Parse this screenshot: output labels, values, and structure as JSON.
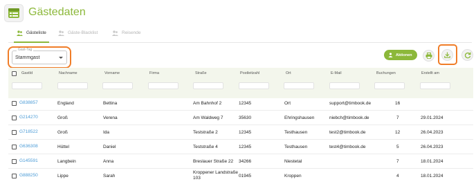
{
  "app": {
    "title": "Gästedaten",
    "icon": "guest-list-icon"
  },
  "tabs": [
    {
      "label": "Gästeliste",
      "icon": "users-icon",
      "active": true
    },
    {
      "label": "Gäste-Blacklist",
      "icon": "users-blocked-icon",
      "active": false
    },
    {
      "label": "Reisende",
      "icon": "travelers-icon",
      "active": false
    }
  ],
  "filter_tag": {
    "label": "Gast-Tag",
    "value": "Stammgast"
  },
  "toolbar": {
    "actions_label": "Aktionen",
    "print_icon": "printer-icon",
    "download_icon": "download-icon",
    "refresh_icon": "refresh-icon"
  },
  "colors": {
    "accent": "#8cb83a",
    "highlight": "#f07d28",
    "link": "#4a9bd6",
    "header_bg": "#f3f6ec"
  },
  "table": {
    "columns": [
      "GastId",
      "Nachname",
      "Vorname",
      "Firma",
      "Straße",
      "Postleitzahl",
      "Ort",
      "E-Mail",
      "Buchungen",
      "Erstellt am"
    ],
    "rows": [
      {
        "id": "G838857",
        "nachname": "England",
        "vorname": "Bettina",
        "firma": "",
        "strasse": "Am Bahnhof 2",
        "plz": "12345",
        "ort": "Ort",
        "email": "support@timbook.de",
        "buchungen": "16",
        "erstellt": ""
      },
      {
        "id": "G214270",
        "nachname": "Groß",
        "vorname": "Verena",
        "firma": "",
        "strasse": "Am Waldweg 7",
        "plz": "35630",
        "ort": "Ehringshausen",
        "email": "niebch@timbook.de",
        "buchungen": "7",
        "erstellt": "29.01.2024"
      },
      {
        "id": "G718522",
        "nachname": "Groß",
        "vorname": "Ida",
        "firma": "",
        "strasse": "Teststraße 2",
        "plz": "12345",
        "ort": "Testhausen",
        "email": "test2@timbook.de",
        "buchungen": "12",
        "erstellt": "26.04.2023"
      },
      {
        "id": "G636308",
        "nachname": "Hüttel",
        "vorname": "Daniel",
        "firma": "",
        "strasse": "Teststraße 4",
        "plz": "12345",
        "ort": "Testhausen",
        "email": "test4@timbook.de",
        "buchungen": "5",
        "erstellt": "26.04.2023"
      },
      {
        "id": "G145591",
        "nachname": "Langbein",
        "vorname": "Anna",
        "firma": "",
        "strasse": "Breslauer Straße 22",
        "plz": "34266",
        "ort": "Niestetal",
        "email": "",
        "buchungen": "7",
        "erstellt": "18.01.2024"
      },
      {
        "id": "G888250",
        "nachname": "Lippe",
        "vorname": "Sarah",
        "firma": "",
        "strasse": "Kroppener Landstraße 103",
        "plz": "01945",
        "ort": "Kroppen",
        "email": "",
        "buchungen": "4",
        "erstellt": "18.01.2024"
      }
    ]
  }
}
